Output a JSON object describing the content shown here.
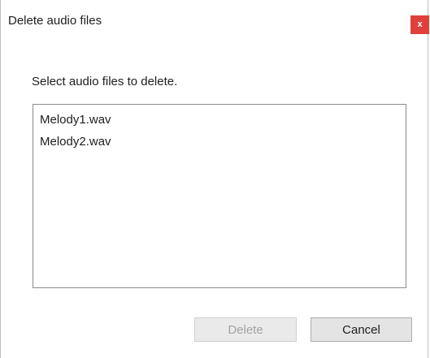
{
  "window": {
    "title": "Delete audio files",
    "close_label": "x"
  },
  "content": {
    "prompt": "Select audio files to delete.",
    "files": [
      "Melody1.wav",
      "Melody2.wav"
    ]
  },
  "buttons": {
    "delete_label": "Delete",
    "delete_enabled": false,
    "cancel_label": "Cancel"
  },
  "colors": {
    "close_button": "#e0403c",
    "disabled_text": "#a3a3a3"
  }
}
